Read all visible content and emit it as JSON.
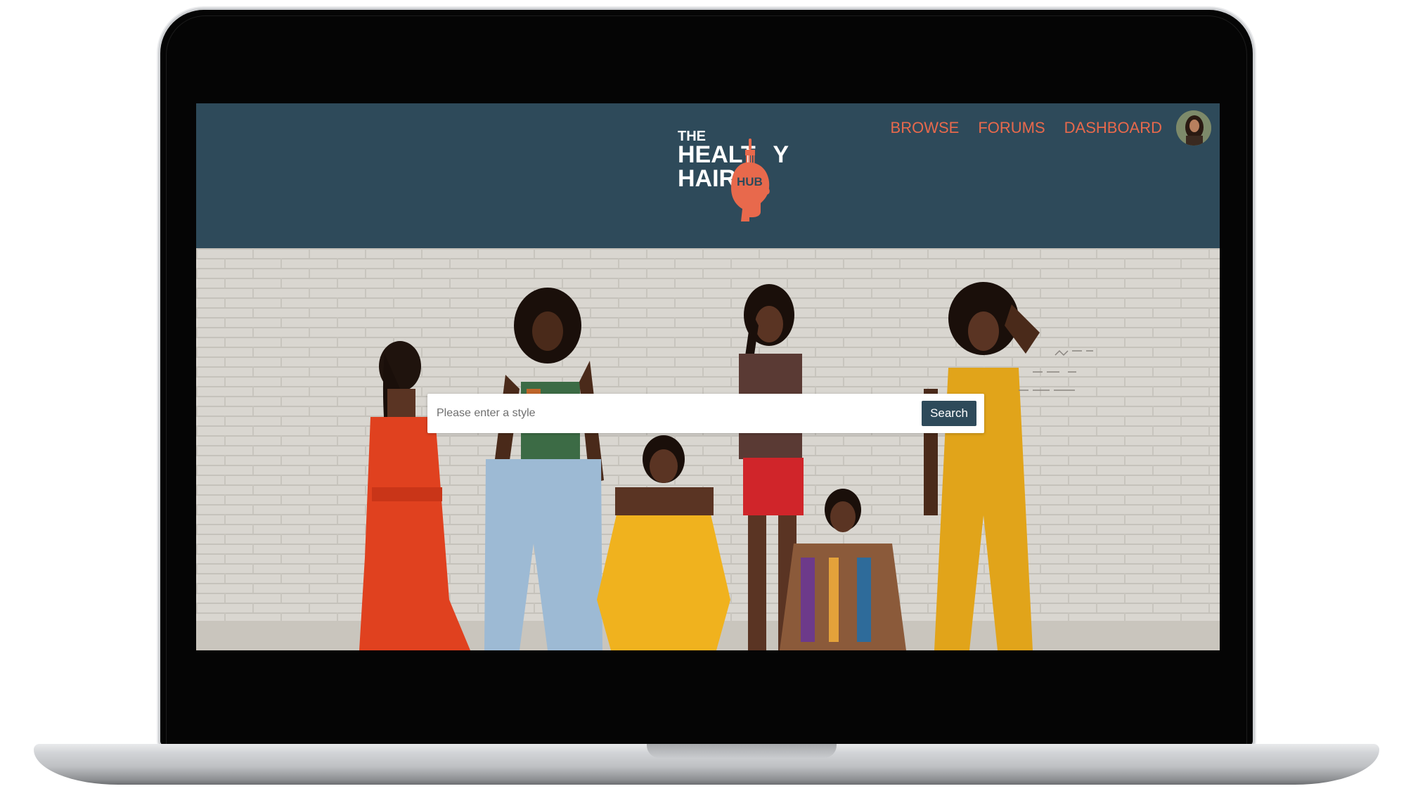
{
  "brand": {
    "logo_line1": "THE",
    "logo_line2": "HEALTHY",
    "logo_line3": "HAIR",
    "logo_badge": "HUB"
  },
  "nav": {
    "items": [
      {
        "label": "BROWSE"
      },
      {
        "label": "FORUMS"
      },
      {
        "label": "DASHBOARD"
      }
    ]
  },
  "search": {
    "placeholder": "Please enter a style",
    "value": "",
    "button_label": "Search"
  },
  "colors": {
    "header_bg": "#2e4a5a",
    "nav_link": "#e8694c",
    "logo_accent": "#e8694c",
    "button_bg": "#2e4a5a"
  },
  "icons": {
    "avatar": "user-avatar-photo",
    "logo_mark": "head-silhouette-with-hair-pick"
  }
}
